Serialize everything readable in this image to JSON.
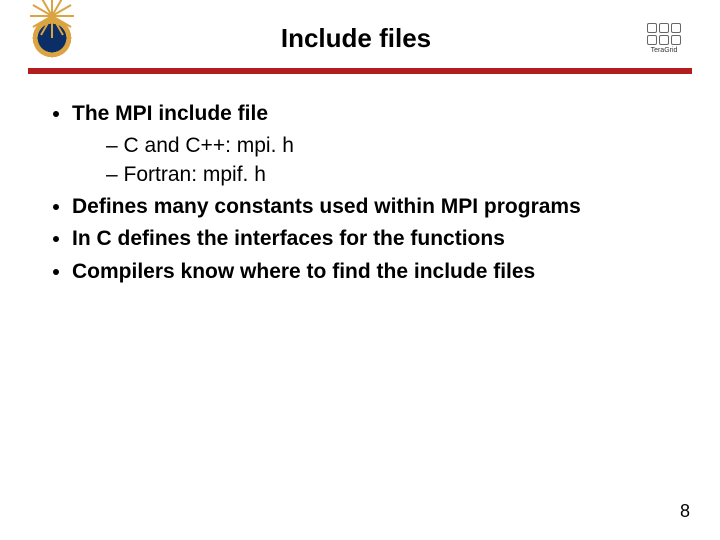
{
  "header": {
    "title": "Include files",
    "left_logo": "nsf-seal",
    "right_logo_label": "TeraGrid"
  },
  "bullets1": {
    "item": "The MPI include file",
    "subitems": [
      "C and C++: mpi. h",
      "Fortran:  mpif. h"
    ]
  },
  "bullets2": [
    "Defines many constants used within MPI programs",
    "In C defines the interfaces for the functions",
    "Compilers know where to find the include files"
  ],
  "page_number": "8"
}
